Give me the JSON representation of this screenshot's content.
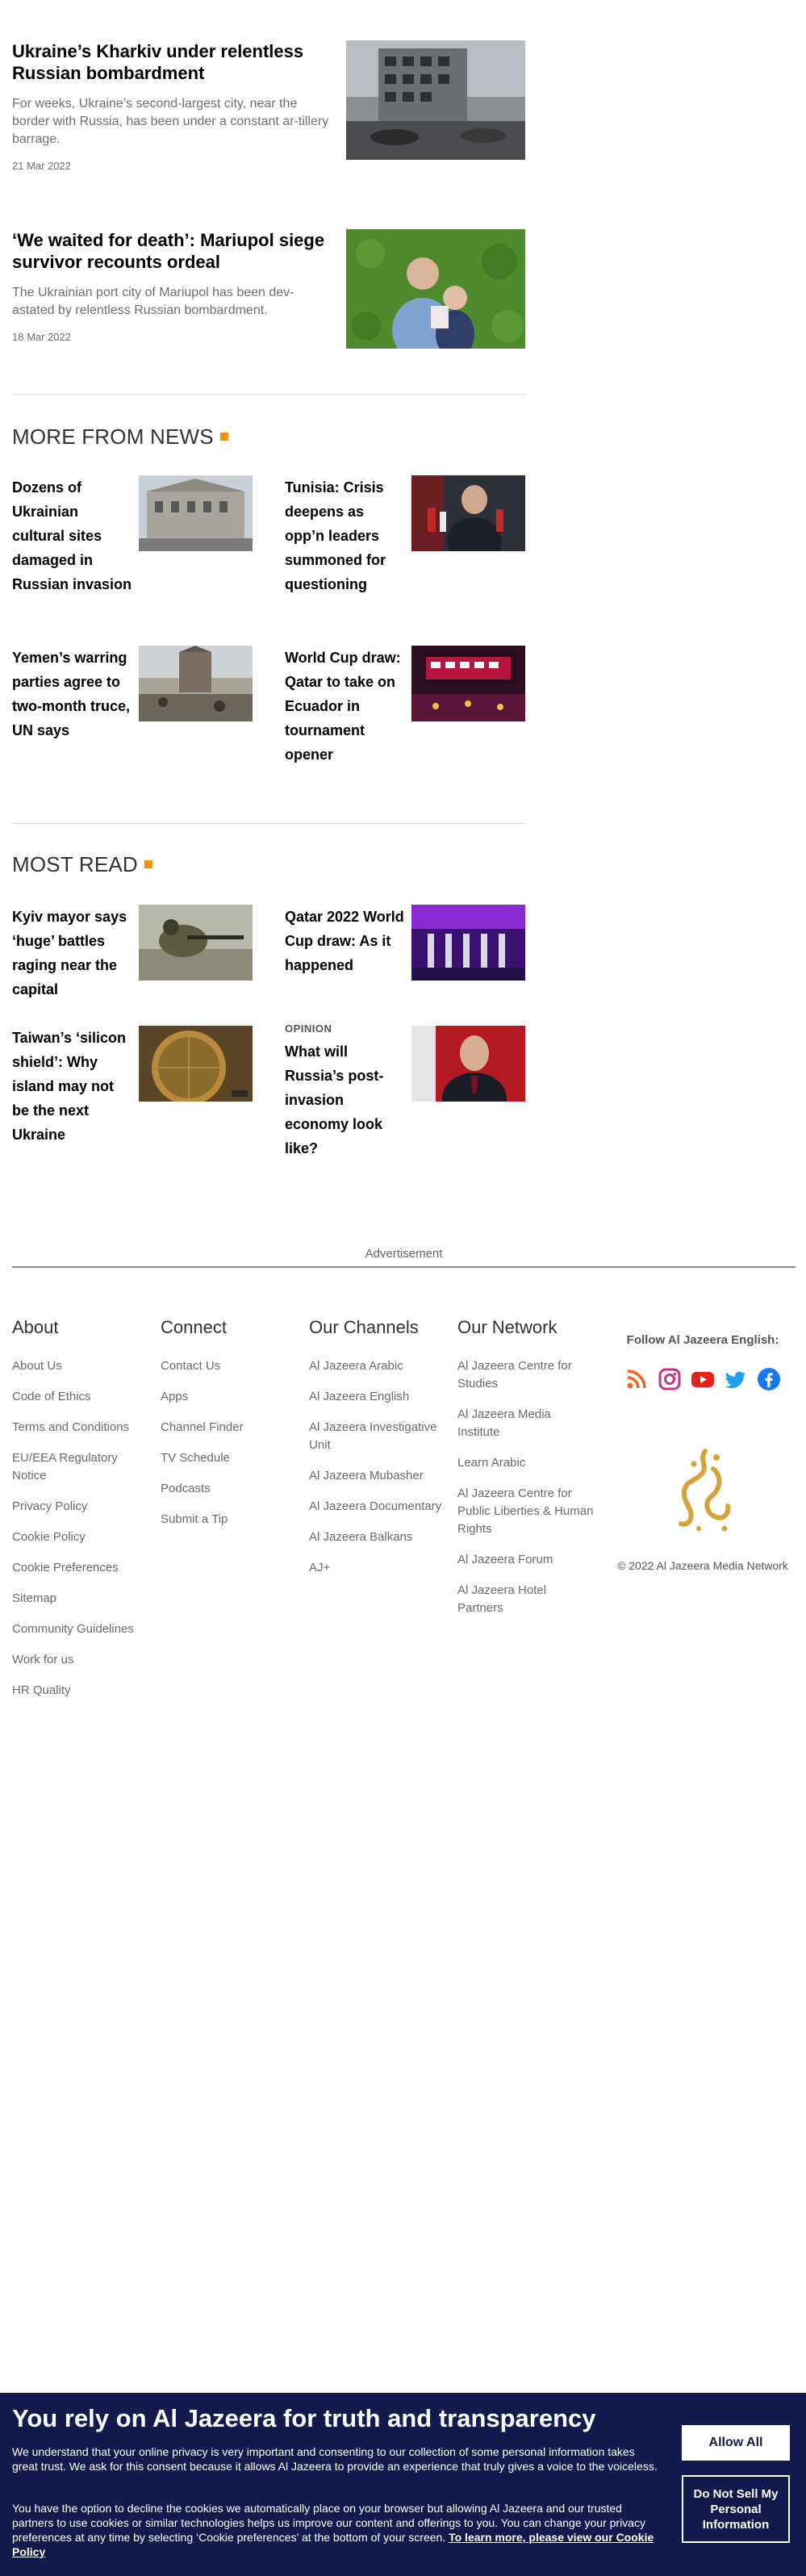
{
  "top_stories": [
    {
      "headline": "Ukraine’s Kharkiv under relentless Russian bombardment",
      "summary": "For weeks, Ukraine’s second-largest city, near the border with Russia, has been under a constant ar-tillery barrage.",
      "date": "21 Mar 2022"
    },
    {
      "headline": "‘We waited for death’: Mariupol siege survivor recounts ordeal",
      "summary": "The Ukrainian port city of Mariupol has been dev-astated by relentless Russian bombardment.",
      "date": "18 Mar 2022"
    }
  ],
  "more_from_news": {
    "title": "MORE FROM NEWS",
    "items": [
      {
        "headline": "Dozens of Ukrainian cultural sites damaged in Russian invasion"
      },
      {
        "headline": "Tunisia: Crisis deepens as opp’n leaders summoned for questioning"
      },
      {
        "headline": "Yemen’s warring parties agree to two-month truce, UN says"
      },
      {
        "headline": "World Cup draw: Qatar to take on Ecuador in tournament opener"
      }
    ]
  },
  "most_read": {
    "title": "MOST READ",
    "items": [
      {
        "kicker": "",
        "headline": "Kyiv mayor says ‘huge’ battles raging near the capital"
      },
      {
        "kicker": "",
        "headline": "Qatar 2022 World Cup draw: As it happened"
      },
      {
        "kicker": "",
        "headline": "Taiwan’s ‘silicon shield’: Why island may not be the next Ukraine"
      },
      {
        "kicker": "OPINION",
        "headline": "What will Russia’s post-invasion economy look like?"
      }
    ]
  },
  "advertisement_label": "Advertisement",
  "footer": {
    "about": {
      "title": "About",
      "links": [
        "About Us",
        "Code of Ethics",
        "Terms and Conditions",
        "EU/EEA Regulatory Notice",
        "Privacy Policy",
        "Cookie Policy",
        "Cookie Preferences",
        "Sitemap",
        "Community Guidelines",
        "Work for us",
        "HR Quality"
      ]
    },
    "connect": {
      "title": "Connect",
      "links": [
        "Contact Us",
        "Apps",
        "Channel Finder",
        "TV Schedule",
        "Podcasts",
        "Submit a Tip"
      ]
    },
    "channels": {
      "title": "Our Channels",
      "links": [
        "Al Jazeera Arabic",
        "Al Jazeera English",
        "Al Jazeera Investigative Unit",
        "Al Jazeera Mubasher",
        "Al Jazeera Documentary",
        "Al Jazeera Balkans",
        "AJ+"
      ]
    },
    "network": {
      "title": "Our Network",
      "links": [
        "Al Jazeera Centre for Studies",
        "Al Jazeera Media Institute",
        "Learn Arabic",
        "Al Jazeera Centre for Public Liberties & Human Rights",
        "Al Jazeera Forum",
        "Al Jazeera Hotel Partners"
      ]
    },
    "follow_title": "Follow Al Jazeera English:",
    "social_icons": [
      "rss-icon",
      "instagram-icon",
      "youtube-icon",
      "twitter-icon",
      "facebook-icon"
    ],
    "copyright": "© 2022 Al Jazeera Media Network"
  },
  "consent": {
    "title": "You rely on Al Jazeera for truth and transparency",
    "paragraph1": "We understand that your online privacy is very important and consenting to our collection of some personal information takes great trust. We ask for this consent because it allows Al Jazeera to provide an experience that truly gives a voice to the voiceless.",
    "paragraph2": "You have the option to decline the cookies we automatically place on your browser but allowing Al Jazeera and our trusted partners to use cookies or similar technologies helps us improve our content and offerings to you. You can change your privacy preferences at any time by selecting ‘Cookie preferences’ at the bottom of your screen.",
    "link": "To learn more, please view our Cookie Policy",
    "allow_all": "Allow All",
    "do_not_sell": "Do Not Sell My Personal Information"
  },
  "colors": {
    "accent_orange": "#fa9000",
    "consent_bg": "#141a4d",
    "text_gray": "#6f6f6f"
  }
}
